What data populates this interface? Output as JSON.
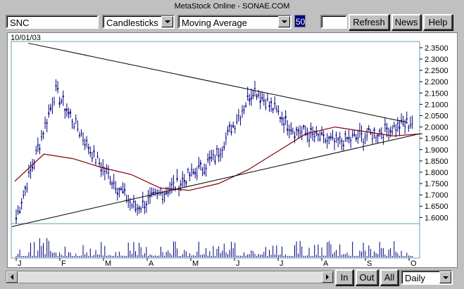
{
  "window": {
    "title": "MetaStock Online - SONAE.COM"
  },
  "toolbar": {
    "symbol": "SNC",
    "chart_type": "Candlesticks",
    "indicator": "Moving Average",
    "period": "50",
    "extra_value": "",
    "refresh_label": "Refresh",
    "news_label": "News",
    "help_label": "Help"
  },
  "chart": {
    "date_label": "10/01/03",
    "colors": {
      "candle": "#000080",
      "volume": "#000080",
      "moving_average": "#800000",
      "trendline": "#000000"
    }
  },
  "bottom": {
    "in_label": "In",
    "out_label": "Out",
    "all_label": "All",
    "interval": "Daily"
  },
  "chart_data": {
    "type": "candlestick",
    "x_tick_labels": [
      "J",
      "F",
      "M",
      "A",
      "M",
      "J",
      "J",
      "A",
      "S",
      "O"
    ],
    "y_tick_labels": [
      "1.6000",
      "1.6500",
      "1.7000",
      "1.7500",
      "1.8000",
      "1.8500",
      "1.9000",
      "1.9500",
      "2.0000",
      "2.0500",
      "2.1000",
      "2.1500",
      "2.2000",
      "2.2500",
      "2.3000",
      "2.3500"
    ],
    "ylim": [
      1.57,
      2.39
    ],
    "monthly_close": [
      1.6,
      2.16,
      1.86,
      1.64,
      1.74,
      1.86,
      2.17,
      1.99,
      1.93,
      1.97,
      2.02
    ],
    "moving_average": [
      1.76,
      1.88,
      1.86,
      1.82,
      1.79,
      1.73,
      1.72,
      1.75,
      1.81,
      1.89,
      1.97,
      2.0,
      1.98,
      1.96,
      1.97
    ],
    "trendlines": [
      {
        "name": "resistance",
        "from": [
          0.04,
          2.37
        ],
        "to": [
          0.97,
          2.02
        ]
      },
      {
        "name": "support",
        "from": [
          0.0,
          1.56
        ],
        "to": [
          1.0,
          1.97
        ]
      }
    ],
    "grid": false
  }
}
